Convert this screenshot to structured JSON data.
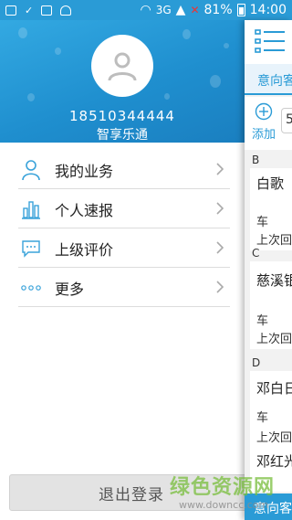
{
  "status_bar": {
    "network": "3G",
    "battery": "81%",
    "time": "14:00"
  },
  "profile": {
    "phone": "18510344444",
    "name": "智享乐通"
  },
  "menu": [
    {
      "label": "我的业务",
      "icon": "person-icon"
    },
    {
      "label": "个人速报",
      "icon": "bar-chart-icon"
    },
    {
      "label": "上级评价",
      "icon": "comment-icon"
    },
    {
      "label": "更多",
      "icon": "more-dots-icon"
    }
  ],
  "logout_label": "退出登录",
  "main": {
    "tab_label": "意向客",
    "add_label": "添加",
    "field_value": "5",
    "sections": [
      {
        "letter": "B",
        "name": "白歌",
        "meta1": "车",
        "meta2": "上次回"
      },
      {
        "letter": "C",
        "name": "慈溪银",
        "meta1": "车",
        "meta2": "上次回"
      },
      {
        "letter": "D",
        "name": "邓白日",
        "meta1": "车",
        "meta2": "上次回",
        "name2": "邓红光"
      }
    ],
    "bottom_tab": "意向客"
  },
  "watermark": {
    "title": "绿色资源网",
    "url": "www.downcc.com"
  },
  "colors": {
    "accent": "#2a9bd6",
    "text": "#222222",
    "divider": "#dcdcdc"
  }
}
